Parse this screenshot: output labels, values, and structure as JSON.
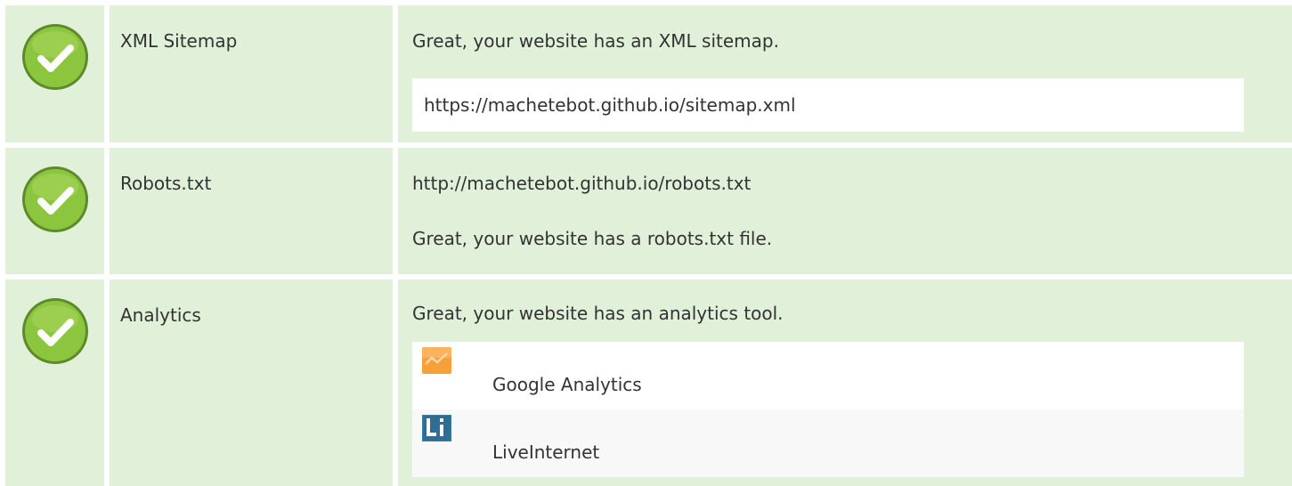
{
  "rows": [
    {
      "name": "XML Sitemap",
      "status": "pass",
      "message": "Great, your website has an XML sitemap.",
      "detail": "https://machetebot.github.io/sitemap.xml"
    },
    {
      "name": "Robots.txt",
      "status": "pass",
      "detail": "http://machetebot.github.io/robots.txt",
      "message": "Great, your website has a robots.txt file."
    },
    {
      "name": "Analytics",
      "status": "pass",
      "message": "Great, your website has an analytics tool.",
      "tools": [
        {
          "label": "Google Analytics",
          "icon": "google-analytics-icon"
        },
        {
          "label": "LiveInternet",
          "icon": "liveinternet-icon"
        }
      ]
    }
  ],
  "colors": {
    "row_bg": "#e0f0d9",
    "check_green": "#8cc63f",
    "check_border": "#5f8a2a",
    "ga_orange": "#f6a03a",
    "li_blue": "#3d7ea6"
  }
}
